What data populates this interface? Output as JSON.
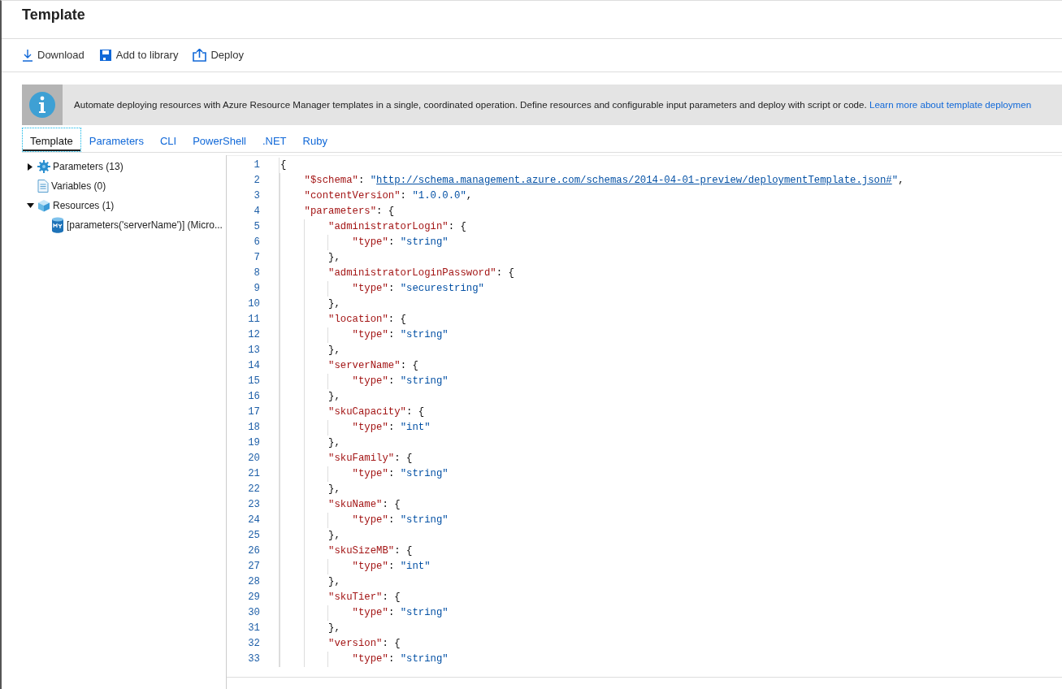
{
  "title": "Template",
  "toolbar": [
    {
      "kind": "download",
      "label": "Download"
    },
    {
      "kind": "save",
      "label": "Add to library"
    },
    {
      "kind": "deploy",
      "label": "Deploy"
    }
  ],
  "info": {
    "text": "Automate deploying resources with Azure Resource Manager templates in a single, coordinated operation. Define resources and configurable input parameters and deploy with script or code.",
    "link": "Learn more about template deploymen"
  },
  "tabs": [
    {
      "label": "Template",
      "selected": true
    },
    {
      "label": "Parameters",
      "selected": false
    },
    {
      "label": "CLI",
      "selected": false
    },
    {
      "label": "PowerShell",
      "selected": false
    },
    {
      "label": ".NET",
      "selected": false
    },
    {
      "label": "Ruby",
      "selected": false
    }
  ],
  "tree": [
    {
      "kind": "gear",
      "label": "Parameters (13)",
      "expanded": false
    },
    {
      "kind": "document",
      "label": "Variables (0)"
    },
    {
      "kind": "cube",
      "label": "Resources (1)",
      "expanded": true,
      "children": [
        {
          "kind": "database",
          "label": "[parameters('serverName')] (Micro..."
        }
      ]
    }
  ],
  "code_lines": [
    {
      "number": "1",
      "tokens": [
        {
          "kind": "punct",
          "text": "{"
        }
      ]
    },
    {
      "number": "2",
      "tokens": [
        {
          "kind": "key",
          "text": "\"$schema\""
        },
        {
          "kind": "punct",
          "text": ": "
        },
        {
          "kind": "str",
          "text": "\""
        },
        {
          "kind": "link",
          "text": "http://schema.management.azure.com/schemas/2014-04-01-preview/deploymentTemplate.json#"
        },
        {
          "kind": "str",
          "text": "\""
        },
        {
          "kind": "punct",
          "text": ","
        }
      ]
    },
    {
      "number": "3",
      "tokens": [
        {
          "kind": "key",
          "text": "\"contentVersion\""
        },
        {
          "kind": "punct",
          "text": ": "
        },
        {
          "kind": "str",
          "text": "\"1.0.0.0\""
        },
        {
          "kind": "punct",
          "text": ","
        }
      ]
    },
    {
      "number": "4",
      "tokens": [
        {
          "kind": "key",
          "text": "\"parameters\""
        },
        {
          "kind": "punct",
          "text": ": {"
        }
      ]
    },
    {
      "number": "5",
      "tokens": [
        {
          "kind": "key",
          "text": "\"administratorLogin\""
        },
        {
          "kind": "punct",
          "text": ": {"
        }
      ]
    },
    {
      "number": "6",
      "tokens": [
        {
          "kind": "key",
          "text": "\"type\""
        },
        {
          "kind": "punct",
          "text": ": "
        },
        {
          "kind": "str",
          "text": "\"string\""
        }
      ]
    },
    {
      "number": "7",
      "tokens": [
        {
          "kind": "punct",
          "text": "},"
        }
      ]
    },
    {
      "number": "8",
      "tokens": [
        {
          "kind": "key",
          "text": "\"administratorLoginPassword\""
        },
        {
          "kind": "punct",
          "text": ": {"
        }
      ]
    },
    {
      "number": "9",
      "tokens": [
        {
          "kind": "key",
          "text": "\"type\""
        },
        {
          "kind": "punct",
          "text": ": "
        },
        {
          "kind": "str",
          "text": "\"securestring\""
        }
      ]
    },
    {
      "number": "10",
      "tokens": [
        {
          "kind": "punct",
          "text": "},"
        }
      ]
    },
    {
      "number": "11",
      "tokens": [
        {
          "kind": "key",
          "text": "\"location\""
        },
        {
          "kind": "punct",
          "text": ": {"
        }
      ]
    },
    {
      "number": "12",
      "tokens": [
        {
          "kind": "key",
          "text": "\"type\""
        },
        {
          "kind": "punct",
          "text": ": "
        },
        {
          "kind": "str",
          "text": "\"string\""
        }
      ]
    },
    {
      "number": "13",
      "tokens": [
        {
          "kind": "punct",
          "text": "},"
        }
      ]
    },
    {
      "number": "14",
      "tokens": [
        {
          "kind": "key",
          "text": "\"serverName\""
        },
        {
          "kind": "punct",
          "text": ": {"
        }
      ]
    },
    {
      "number": "15",
      "tokens": [
        {
          "kind": "key",
          "text": "\"type\""
        },
        {
          "kind": "punct",
          "text": ": "
        },
        {
          "kind": "str",
          "text": "\"string\""
        }
      ]
    },
    {
      "number": "16",
      "tokens": [
        {
          "kind": "punct",
          "text": "},"
        }
      ]
    },
    {
      "number": "17",
      "tokens": [
        {
          "kind": "key",
          "text": "\"skuCapacity\""
        },
        {
          "kind": "punct",
          "text": ": {"
        }
      ]
    },
    {
      "number": "18",
      "tokens": [
        {
          "kind": "key",
          "text": "\"type\""
        },
        {
          "kind": "punct",
          "text": ": "
        },
        {
          "kind": "str",
          "text": "\"int\""
        }
      ]
    },
    {
      "number": "19",
      "tokens": [
        {
          "kind": "punct",
          "text": "},"
        }
      ]
    },
    {
      "number": "20",
      "tokens": [
        {
          "kind": "key",
          "text": "\"skuFamily\""
        },
        {
          "kind": "punct",
          "text": ": {"
        }
      ]
    },
    {
      "number": "21",
      "tokens": [
        {
          "kind": "key",
          "text": "\"type\""
        },
        {
          "kind": "punct",
          "text": ": "
        },
        {
          "kind": "str",
          "text": "\"string\""
        }
      ]
    },
    {
      "number": "22",
      "tokens": [
        {
          "kind": "punct",
          "text": "},"
        }
      ]
    },
    {
      "number": "23",
      "tokens": [
        {
          "kind": "key",
          "text": "\"skuName\""
        },
        {
          "kind": "punct",
          "text": ": {"
        }
      ]
    },
    {
      "number": "24",
      "tokens": [
        {
          "kind": "key",
          "text": "\"type\""
        },
        {
          "kind": "punct",
          "text": ": "
        },
        {
          "kind": "str",
          "text": "\"string\""
        }
      ]
    },
    {
      "number": "25",
      "tokens": [
        {
          "kind": "punct",
          "text": "},"
        }
      ]
    },
    {
      "number": "26",
      "tokens": [
        {
          "kind": "key",
          "text": "\"skuSizeMB\""
        },
        {
          "kind": "punct",
          "text": ": {"
        }
      ]
    },
    {
      "number": "27",
      "tokens": [
        {
          "kind": "key",
          "text": "\"type\""
        },
        {
          "kind": "punct",
          "text": ": "
        },
        {
          "kind": "str",
          "text": "\"int\""
        }
      ]
    },
    {
      "number": "28",
      "tokens": [
        {
          "kind": "punct",
          "text": "},"
        }
      ]
    },
    {
      "number": "29",
      "tokens": [
        {
          "kind": "key",
          "text": "\"skuTier\""
        },
        {
          "kind": "punct",
          "text": ": {"
        }
      ]
    },
    {
      "number": "30",
      "tokens": [
        {
          "kind": "key",
          "text": "\"type\""
        },
        {
          "kind": "punct",
          "text": ": "
        },
        {
          "kind": "str",
          "text": "\"string\""
        }
      ]
    },
    {
      "number": "31",
      "tokens": [
        {
          "kind": "punct",
          "text": "},"
        }
      ]
    },
    {
      "number": "32",
      "tokens": [
        {
          "kind": "key",
          "text": "\"version\""
        },
        {
          "kind": "punct",
          "text": ": {"
        }
      ]
    },
    {
      "number": "33",
      "tokens": [
        {
          "kind": "key",
          "text": "\"type\""
        },
        {
          "kind": "punct",
          "text": ": "
        },
        {
          "kind": "str",
          "text": "\"string\""
        }
      ]
    }
  ]
}
